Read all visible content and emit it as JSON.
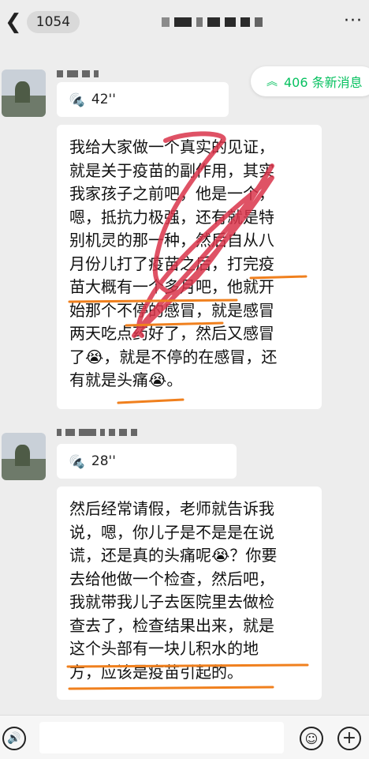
{
  "header": {
    "back_icon": "chevron-left-icon",
    "unread_count": "1054",
    "more_icon": "more-dots-icon",
    "more_glyph": "···"
  },
  "new_messages": {
    "icon": "double-chevron-up-icon",
    "glyph": "︽",
    "label": "406 条新消息"
  },
  "messages": [
    {
      "type": "voice",
      "duration": "42''",
      "icon": "voice-wave-icon"
    },
    {
      "type": "text",
      "lines": [
        "我给大家做一个真实的见证，",
        "就是关于疫苗的副作用，其实",
        "我家孩子之前吧，他是一个，",
        "嗯，抵抗力极强，还有就是特",
        "别机灵的那一种，然后自从八",
        "月份儿打了疫苗之后，打完疫",
        "苗大概有一个多月吧，他就开",
        "始那个不停的感冒，就是感冒",
        "两天吃点药好了，然后又感冒",
        "了😭，就是不停的在感冒，还",
        "有就是头痛😭。"
      ]
    },
    {
      "type": "voice",
      "duration": "28''",
      "icon": "voice-wave-icon"
    },
    {
      "type": "text",
      "lines": [
        "然后经常请假，老师就告诉我",
        "说，嗯，你儿子是不是是在说",
        "谎，还是真的头痛呢😭？你要",
        "去给他做一个检查，然后吧，",
        "我就带我儿子去医院里去做检",
        "查去了，检查结果出来，就是",
        "这个头部有一块儿积水的地",
        "方，应该是疫苗引起的。"
      ]
    }
  ],
  "input_bar": {
    "voice_icon": "voice-input-icon",
    "emoji_icon": "emoji-icon",
    "plus_icon": "plus-icon",
    "plus_glyph": "+"
  },
  "colors": {
    "accent_green": "#07c160",
    "underline_orange": "#f0801e",
    "scribble_red": "#d9344a"
  }
}
